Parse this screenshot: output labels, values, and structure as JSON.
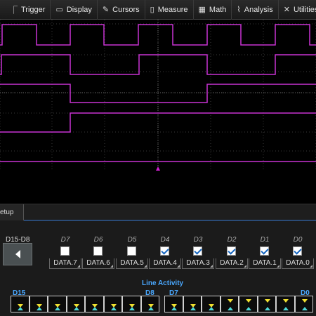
{
  "menu": {
    "items": [
      {
        "label": "Trigger",
        "icon": "trigger-icon",
        "glyph": "⎾"
      },
      {
        "label": "Display",
        "icon": "display-icon",
        "glyph": "▭"
      },
      {
        "label": "Cursors",
        "icon": "cursors-icon",
        "glyph": "✎"
      },
      {
        "label": "Measure",
        "icon": "measure-icon",
        "glyph": "▯"
      },
      {
        "label": "Math",
        "icon": "math-icon",
        "glyph": "▦"
      },
      {
        "label": "Analysis",
        "icon": "analysis-icon",
        "glyph": "⌇"
      },
      {
        "label": "Utilities",
        "icon": "utilities-icon",
        "glyph": "✕"
      }
    ],
    "info_icon": "i"
  },
  "waveform": {
    "trace_color": "#c832d2",
    "trigger_marker_color": "#d020d0"
  },
  "tab": {
    "label": "etup"
  },
  "panel": {
    "group_label": "D15-D8",
    "channels": [
      {
        "name": "D7",
        "checked": false,
        "select": "DATA.7"
      },
      {
        "name": "D6",
        "checked": false,
        "select": "DATA.6"
      },
      {
        "name": "D5",
        "checked": false,
        "select": "DATA.5"
      },
      {
        "name": "D4",
        "checked": true,
        "select": "DATA.4"
      },
      {
        "name": "D3",
        "checked": true,
        "select": "DATA.3"
      },
      {
        "name": "D2",
        "checked": true,
        "select": "DATA.2"
      },
      {
        "name": "D1",
        "checked": true,
        "select": "DATA.1"
      },
      {
        "name": "D0",
        "checked": true,
        "select": "DATA.0"
      }
    ],
    "line_activity": {
      "title": "Line Activity",
      "left_start": "D15",
      "left_end": "D8",
      "right_start": "D7",
      "right_end": "D0"
    }
  }
}
